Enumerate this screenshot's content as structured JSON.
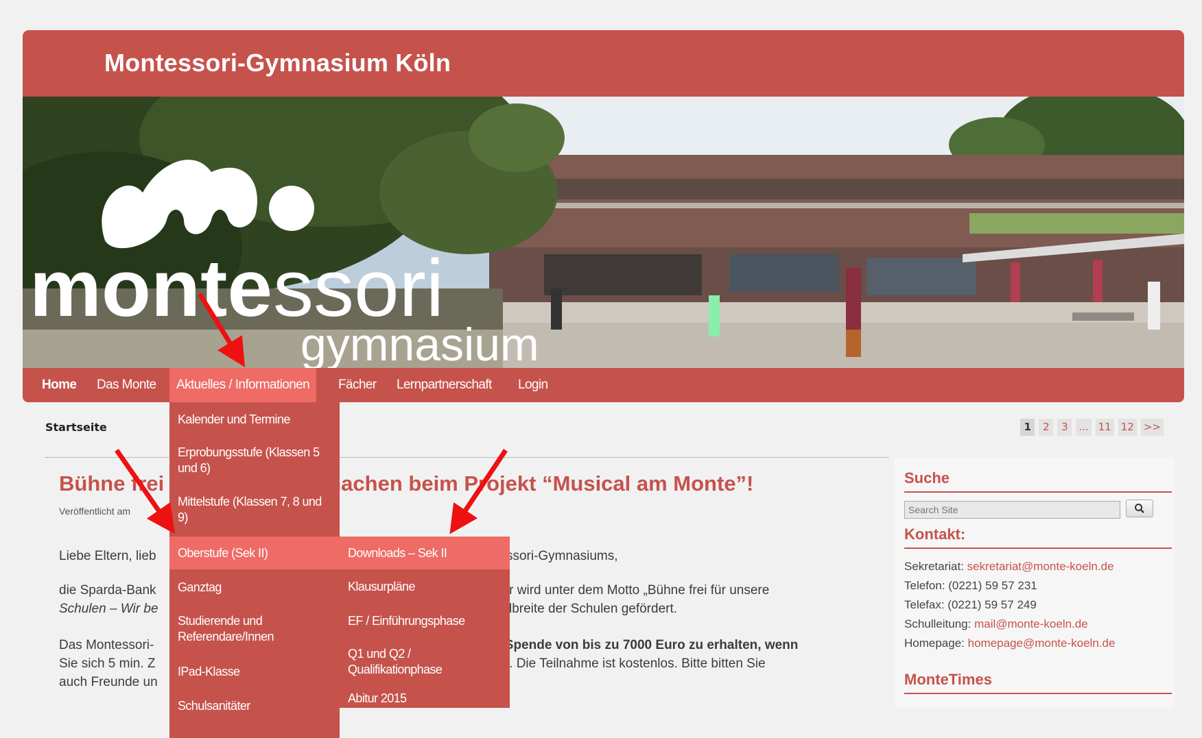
{
  "site": {
    "title": "Montessori-Gymnasium Köln",
    "logo_word1": "monte",
    "logo_word2": "ssori",
    "logo_word3": "gymnasium"
  },
  "nav": {
    "items": [
      {
        "label": "Home"
      },
      {
        "label": "Das Monte"
      },
      {
        "label": "Aktuelles / Informationen"
      },
      {
        "label": "Fächer"
      },
      {
        "label": "Lernpartnerschaft"
      },
      {
        "label": "Login"
      }
    ]
  },
  "dropdown": {
    "items": [
      {
        "label": "Kalender und Termine"
      },
      {
        "label": "Erprobungsstufe (Klassen 5 und 6)"
      },
      {
        "label": "Mittelstufe (Klassen 7, 8 und 9)"
      },
      {
        "label": "Oberstufe (Sek II)"
      },
      {
        "label": "Ganztag"
      },
      {
        "label": "Studierende und Referendare/Innen"
      },
      {
        "label": "IPad-Klasse"
      },
      {
        "label": "Schulsanitäter"
      }
    ],
    "submenu": [
      {
        "label": "Downloads – Sek II"
      },
      {
        "label": "Klausurpläne"
      },
      {
        "label": "EF / Einführungsphase"
      },
      {
        "label": "Q1 und Q2 / Qualifikationphase"
      },
      {
        "label": "Abitur 2015"
      }
    ]
  },
  "breadcrumb": "Startseite",
  "pagination": [
    "1",
    "2",
    "3",
    "...",
    "11",
    "12",
    ">>"
  ],
  "article": {
    "title_a": "Bühne frei",
    "title_b": "tmachen beim Projekt “Musical am Monte”!",
    "published": "Veröffentlicht am",
    "p1_a": "Liebe Eltern, lieb",
    "p1_b": "ntessori-Gymnasiums,",
    "p2_a": "die Sparda-Bank",
    "p2_b": "Jahr wird unter dem Motto „Bühne frei für unsere",
    "p2_c": "Schulen – Wir be",
    "p2_d": "andbreite der Schulen gefördert.",
    "p3_a": "Das Montessori-",
    "p3_b": "ne Spende von bis zu 7000 Euro zu erhalten, wenn",
    "p3_c": "Sie sich 5 min. Z",
    "p3_d": "ben. Die Teilnahme ist kostenlos. Bitte bitten Sie",
    "p3_e": "auch Freunde un"
  },
  "sidebar": {
    "search_title": "Suche",
    "search_placeholder": "Search Site",
    "contact_title": "Kontakt:",
    "contact": [
      {
        "label": "Sekretariat: ",
        "value": "sekretariat@monte-koeln.de"
      },
      {
        "label": "Telefon: (0221) 59 57 231",
        "value": ""
      },
      {
        "label": "Telefax: (0221) 59 57 249",
        "value": ""
      },
      {
        "label": "Schulleitung: ",
        "value": "mail@monte-koeln.de"
      },
      {
        "label": "Homepage: ",
        "value": "homepage@monte-koeln.de"
      }
    ],
    "montetimes_title": "MonteTimes"
  },
  "colors": {
    "brand": "#c6524c",
    "active": "#ee6b66",
    "arrow": "#ee1111"
  }
}
